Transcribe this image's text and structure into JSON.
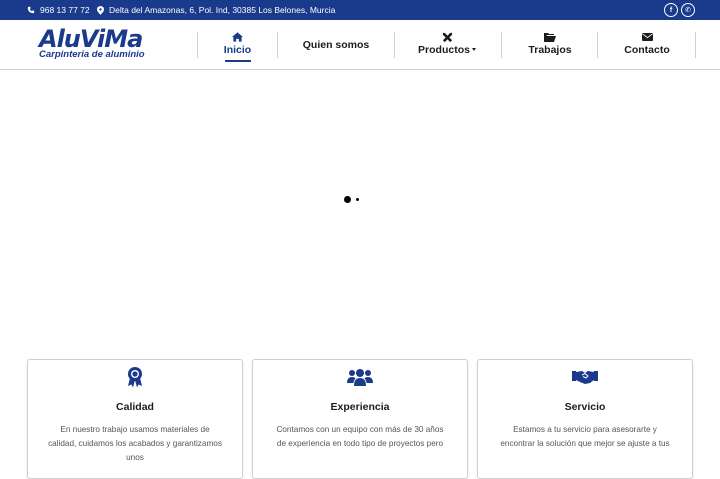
{
  "topbar": {
    "phone": "968 13 77 72",
    "address": "Delta del Amazonas, 6, Pol. Ind, 30385 Los Belones, Murcia",
    "social": [
      {
        "icon": "facebook-icon",
        "glyph": "f"
      },
      {
        "icon": "whatsapp-icon",
        "glyph": "✆"
      }
    ]
  },
  "logo": {
    "brand": "AluViMa",
    "tagline": "Carpinteria de aluminio"
  },
  "nav": {
    "items": [
      {
        "label": "Inicio",
        "icon": "home-icon",
        "active": true
      },
      {
        "label": "Quien somos",
        "icon": null
      },
      {
        "label": "Productos",
        "icon": "tools-icon",
        "dropdown": true
      },
      {
        "label": "Trabajos",
        "icon": "folder-icon"
      },
      {
        "label": "Contacto",
        "icon": "envelope-icon"
      }
    ]
  },
  "features": [
    {
      "icon": "award-ribbon-icon",
      "title": "Calidad",
      "text": "En nuestro trabajo usamos materiales de calidad, cuidamos los acabados y garantizamos unos"
    },
    {
      "icon": "users-group-icon",
      "title": "Experiencia",
      "text": "Contamos con un equipo con más de 30 años de experiencia en todo tipo de proyectos pero"
    },
    {
      "icon": "handshake-icon",
      "title": "Servicio",
      "text": "Estamos a tu servicio para asesorarte y encontrar la solución que mejor se ajuste a tus"
    }
  ],
  "colors": {
    "brand": "#1a3a8c",
    "text": "#1c1c1c",
    "muted": "#555555"
  }
}
